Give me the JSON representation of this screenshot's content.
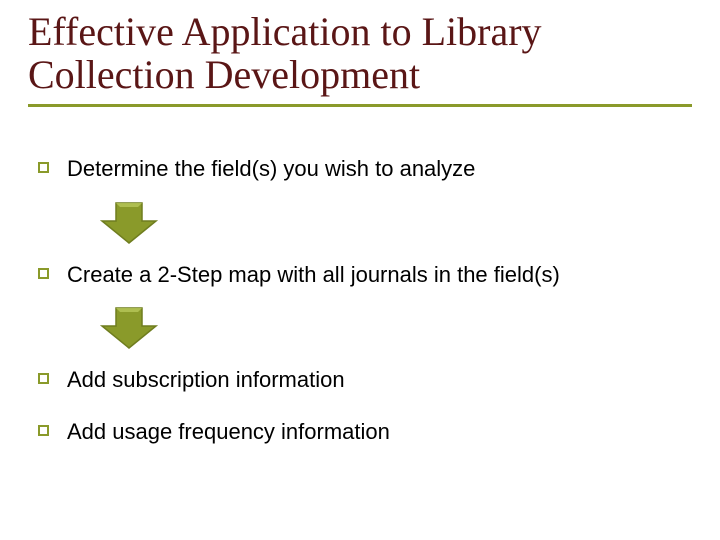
{
  "title": "Effective Application to Library Collection Development",
  "bullets": [
    "Determine the field(s) you wish to analyze",
    "Create a 2-Step map with all journals in the field(s)",
    "Add subscription information",
    "Add usage frequency information"
  ],
  "colors": {
    "title": "#5a1616",
    "accent": "#8a9a2a",
    "arrow_fill": "#8a9a2a",
    "arrow_stroke": "#6f7d1f"
  }
}
